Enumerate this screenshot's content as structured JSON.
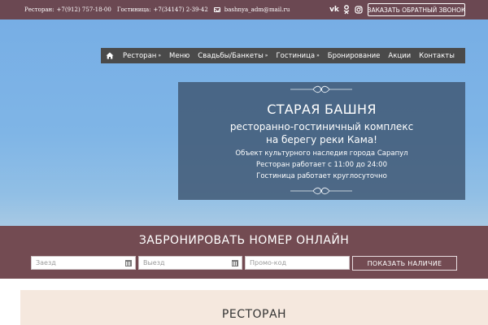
{
  "topbar": {
    "restaurant_label": "Ресторан:",
    "restaurant_phone": "+7(912) 757-18-00",
    "hotel_label": "Гостиница:",
    "hotel_phone": "+7(34147) 2-39-42",
    "email": "bashnya_adm@mail.ru",
    "socials": [
      {
        "icon": "vk-icon",
        "glyph": "vk"
      },
      {
        "icon": "odnoklassniki-icon",
        "glyph": "ok"
      },
      {
        "icon": "instagram-icon",
        "glyph": "◎"
      }
    ],
    "callback_label": "ЗАКАЗАТЬ ОБРАТНЫЙ ЗВОНОК"
  },
  "menu": {
    "home_icon": "home-icon",
    "items": [
      {
        "label": "Ресторан",
        "dropdown": true
      },
      {
        "label": "Меню",
        "dropdown": false
      },
      {
        "label": "Свадьбы/Банкеты",
        "dropdown": true
      },
      {
        "label": "Гостиница",
        "dropdown": true
      },
      {
        "label": "Бронирование",
        "dropdown": false
      },
      {
        "label": "Акции",
        "dropdown": false
      },
      {
        "label": "Контакты",
        "dropdown": false
      }
    ]
  },
  "hero": {
    "title": "СТАРАЯ БАШНЯ",
    "subtitle_line1": "ресторанно-гостиничный комплекс",
    "subtitle_line2": "на берегу реки Кама!",
    "info1": "Объект культурного наследия города Сарапул",
    "info2": "Ресторан работает с 11:00 до 24:00",
    "info3": "Гостиница работает круглосуточно"
  },
  "booking": {
    "title": "ЗАБРОНИРОВАТЬ НОМЕР ОНЛАЙН",
    "checkin_placeholder": "Заезд",
    "checkout_placeholder": "Выезд",
    "promo_placeholder": "Промо-код",
    "button_label": "ПОКАЗАТЬ НАЛИЧИЕ"
  },
  "section": {
    "heading": "РЕСТОРАН"
  },
  "colors": {
    "topbar": "#6b4852",
    "booking_band": "#734b52",
    "menu_bg": "#4a4a4a",
    "infobox": "#3e5670"
  }
}
